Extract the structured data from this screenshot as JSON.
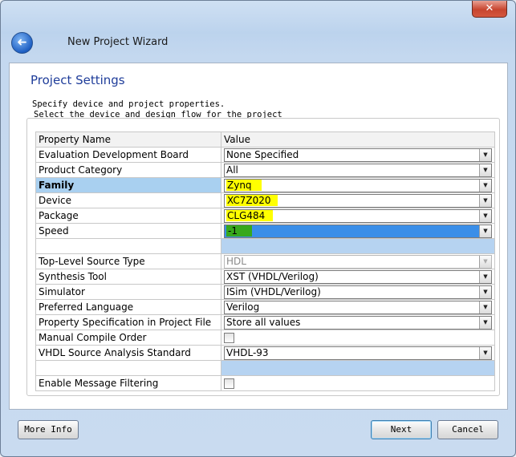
{
  "window": {
    "title": "New Project Wizard",
    "close_symbol": "✕",
    "back_symbol": "➜"
  },
  "section": {
    "title": "Project Settings"
  },
  "description": {
    "line1": "Specify device and project properties.",
    "line2": "Select the device and design flow for the project"
  },
  "table": {
    "header": {
      "name": "Property Name",
      "value": "Value"
    },
    "rows": {
      "eval_board": {
        "name": "Evaluation Development Board",
        "value": "None Specified"
      },
      "product_category": {
        "name": "Product Category",
        "value": "All"
      },
      "family": {
        "name": "Family",
        "value": "Zynq"
      },
      "device": {
        "name": "Device",
        "value": "XC7Z020"
      },
      "package": {
        "name": "Package",
        "value": "CLG484"
      },
      "speed": {
        "name": "Speed",
        "value": "-1"
      },
      "top_level_source": {
        "name": "Top-Level Source Type",
        "value": "HDL"
      },
      "synthesis_tool": {
        "name": "Synthesis Tool",
        "value": "XST (VHDL/Verilog)"
      },
      "simulator": {
        "name": "Simulator",
        "value": "ISim (VHDL/Verilog)"
      },
      "preferred_language": {
        "name": "Preferred Language",
        "value": "Verilog"
      },
      "property_spec": {
        "name": "Property Specification in Project File",
        "value": "Store all values"
      },
      "manual_compile": {
        "name": "Manual Compile Order",
        "checked": false
      },
      "vhdl_standard": {
        "name": "VHDL Source Analysis Standard",
        "value": "VHDL-93"
      },
      "message_filtering": {
        "name": "Enable Message Filtering",
        "checked": false
      }
    }
  },
  "buttons": {
    "more_info": "More Info",
    "next": "Next",
    "cancel": "Cancel"
  },
  "colors": {
    "highlight": "#ffff00",
    "selection": "#3a8ee8",
    "title_blue": "#1f3d9a"
  },
  "icons": {
    "back": "back-arrow-icon",
    "close": "close-icon",
    "dropdown": "chevron-down-icon"
  }
}
